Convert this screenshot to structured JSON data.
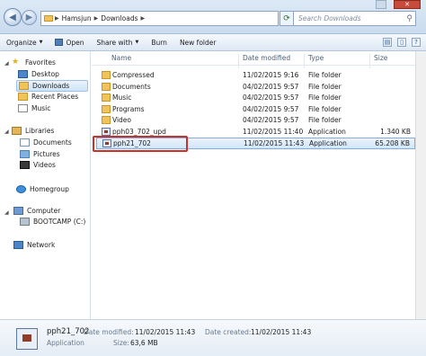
{
  "address": {
    "crumbs": [
      "Hamsjun",
      "Downloads"
    ],
    "search_placeholder": "Search Downloads"
  },
  "toolbar": {
    "organize": "Organize",
    "open": "Open",
    "share_with": "Share with",
    "burn": "Burn",
    "new_folder": "New folder"
  },
  "nav": {
    "favorites": "Favorites",
    "desktop": "Desktop",
    "downloads": "Downloads",
    "recent_places": "Recent Places",
    "music": "Music",
    "libraries": "Libraries",
    "documents": "Documents",
    "pictures": "Pictures",
    "videos": "Videos",
    "homegroup": "Homegroup",
    "computer": "Computer",
    "bootcamp": "BOOTCAMP (C:)",
    "network": "Network"
  },
  "columns": {
    "name": "Name",
    "date": "Date modified",
    "type": "Type",
    "size": "Size"
  },
  "files": [
    {
      "name": "Compressed",
      "date": "11/02/2015 9:16",
      "type": "File folder",
      "size": "",
      "icon": "folder-icon"
    },
    {
      "name": "Documents",
      "date": "04/02/2015 9:57",
      "type": "File folder",
      "size": "",
      "icon": "folder-icon"
    },
    {
      "name": "Music",
      "date": "04/02/2015 9:57",
      "type": "File folder",
      "size": "",
      "icon": "folder-icon"
    },
    {
      "name": "Programs",
      "date": "04/02/2015 9:57",
      "type": "File folder",
      "size": "",
      "icon": "folder-icon"
    },
    {
      "name": "Video",
      "date": "04/02/2015 9:57",
      "type": "File folder",
      "size": "",
      "icon": "folder-icon"
    },
    {
      "name": "pph03_702_upd",
      "date": "11/02/2015 11:40",
      "type": "Application",
      "size": "1.340 KB",
      "icon": "application-icon"
    },
    {
      "name": "pph21_702",
      "date": "11/02/2015 11:43",
      "type": "Application",
      "size": "65.208 KB",
      "icon": "application-icon"
    }
  ],
  "details": {
    "name": "pph21_702",
    "date_modified_label": "Date modified:",
    "date_modified": "11/02/2015 11:43",
    "date_created_label": "Date created:",
    "date_created": "11/02/2015 11:43",
    "type": "Application",
    "size_label": "Size:",
    "size": "63,6 MB"
  },
  "colors": {
    "highlight_border": "#c8312a",
    "selection": "#d1e6f9"
  }
}
